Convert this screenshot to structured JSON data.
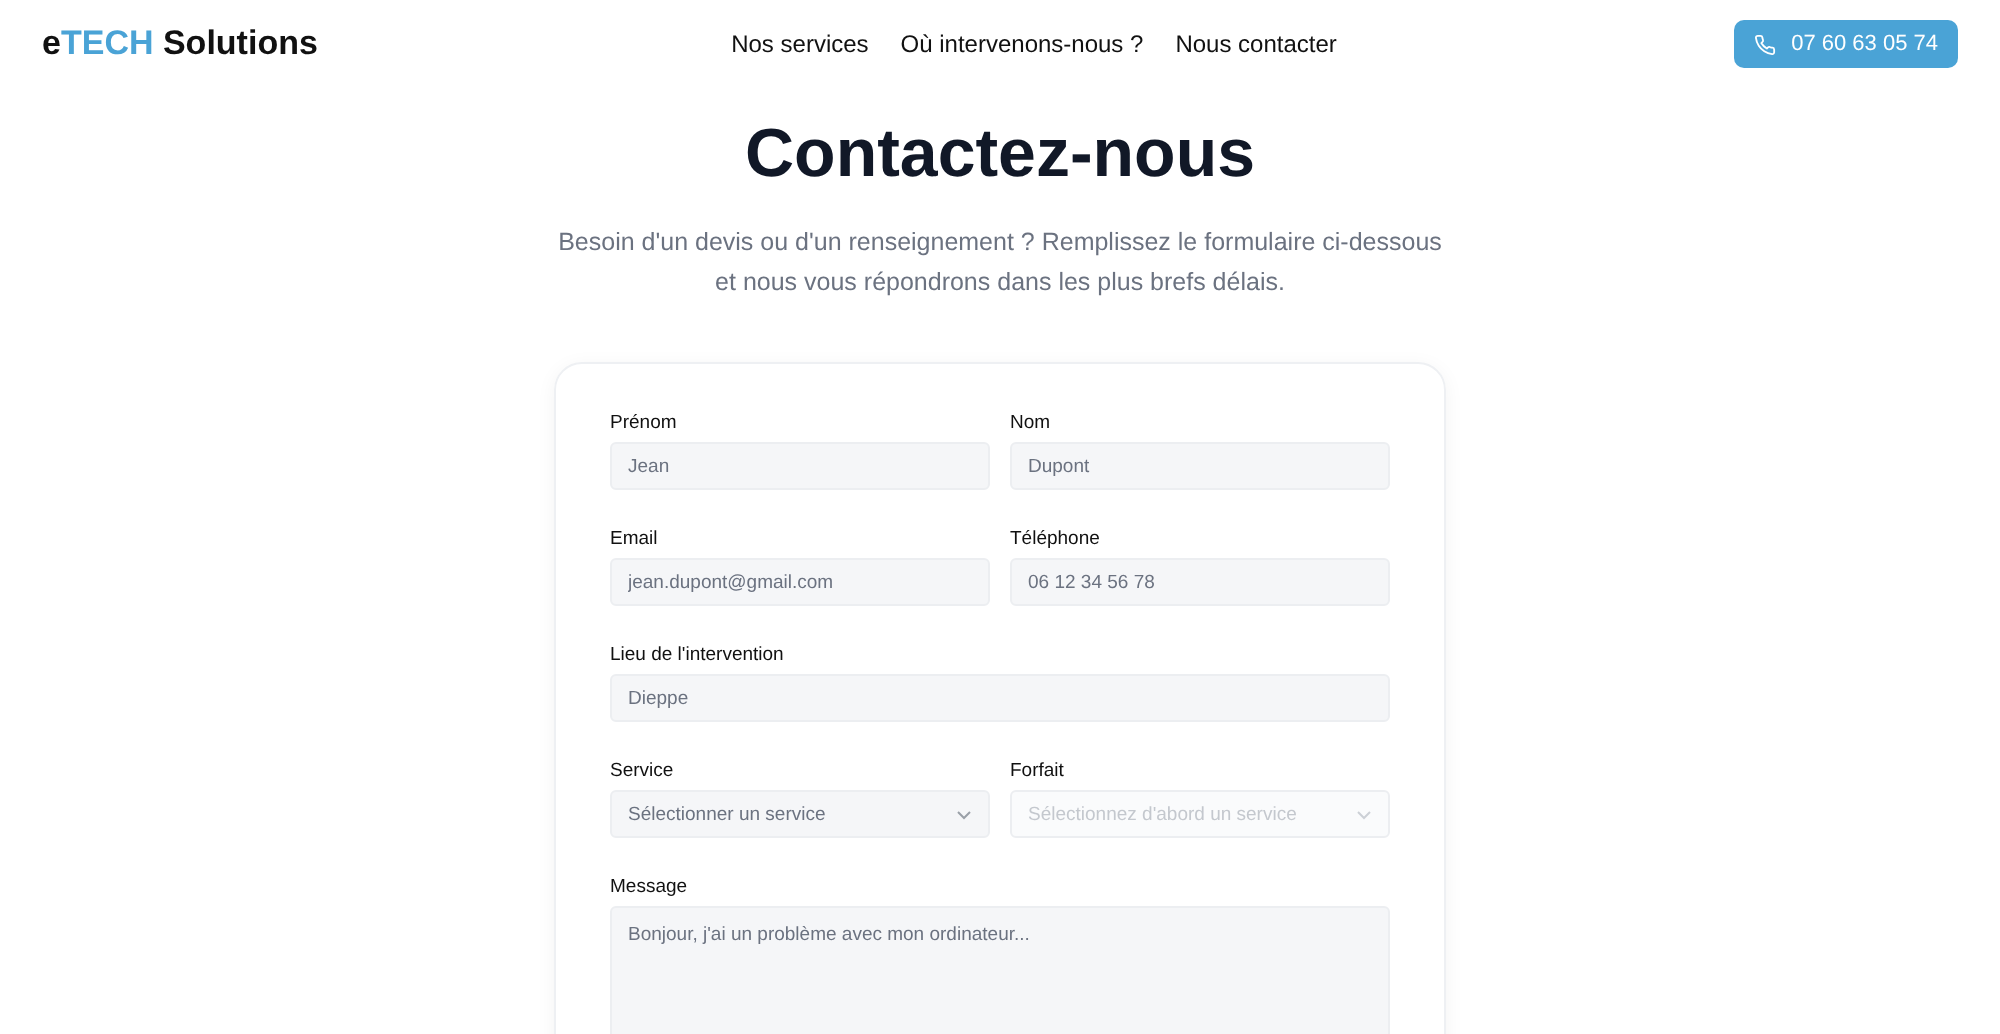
{
  "header": {
    "logo": {
      "prefix": "e",
      "accent": "TECH",
      "suffix": " Solutions"
    },
    "nav": [
      "Nos services",
      "Où intervenons-nous ?",
      "Nous contacter"
    ],
    "phone_button": "07 60 63 05 74"
  },
  "title": "Contactez-nous",
  "subtitle": "Besoin d'un devis ou d'un renseignement ? Remplissez le formulaire ci-dessous et nous vous répondrons dans les plus brefs délais.",
  "form": {
    "fields": [
      {
        "kind": "input",
        "label": "Prénom",
        "placeholder": "Jean",
        "wide": false,
        "disabled": false
      },
      {
        "kind": "input",
        "label": "Nom",
        "placeholder": "Dupont",
        "wide": false,
        "disabled": false
      },
      {
        "kind": "input",
        "label": "Email",
        "placeholder": "jean.dupont@gmail.com",
        "wide": false,
        "disabled": false
      },
      {
        "kind": "input",
        "label": "Téléphone",
        "placeholder": "06 12 34 56 78",
        "wide": false,
        "disabled": false
      },
      {
        "kind": "input",
        "label": "Lieu de l'intervention",
        "placeholder": "Dieppe",
        "wide": true,
        "disabled": false
      },
      {
        "kind": "select",
        "label": "Service",
        "placeholder": "Sélectionner un service",
        "wide": false,
        "disabled": false
      },
      {
        "kind": "select",
        "label": "Forfait",
        "placeholder": "Sélectionnez d'abord un service",
        "wide": false,
        "disabled": true
      },
      {
        "kind": "textarea",
        "label": "Message",
        "placeholder": "Bonjour, j'ai un problème avec mon ordinateur...",
        "wide": true,
        "disabled": false
      }
    ]
  }
}
